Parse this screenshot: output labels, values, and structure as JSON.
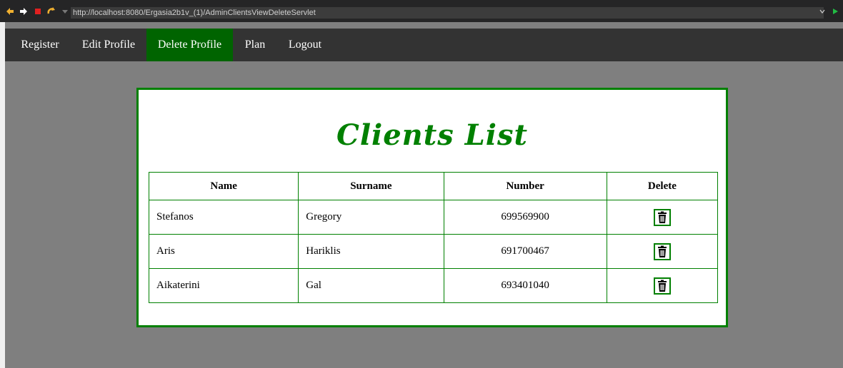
{
  "browser": {
    "url": "http://localhost:8080/Ergasia2b1v_(1)/AdminClientsViewDeleteServlet"
  },
  "menu": {
    "items": [
      {
        "label": "Register"
      },
      {
        "label": "Edit Profile"
      },
      {
        "label": "Delete Profile",
        "active": true
      },
      {
        "label": "Plan"
      },
      {
        "label": "Logout"
      }
    ]
  },
  "page": {
    "title": "Clients List"
  },
  "table": {
    "headers": [
      "Name",
      "Surname",
      "Number",
      "Delete"
    ],
    "rows": [
      {
        "name": "Stefanos",
        "surname": "Gregory",
        "number": "699569900",
        "delete_icon": "trash-icon"
      },
      {
        "name": "Aris",
        "surname": "Hariklis",
        "number": "691700467",
        "delete_icon": "trash-icon"
      },
      {
        "name": "Aikaterini",
        "surname": "Gal",
        "number": "693401040",
        "delete_icon": "trash-icon"
      }
    ]
  },
  "colors": {
    "accent": "#008000",
    "active_menu": "#006400",
    "menubar": "#333333",
    "page_background": "#7f7f7f"
  }
}
